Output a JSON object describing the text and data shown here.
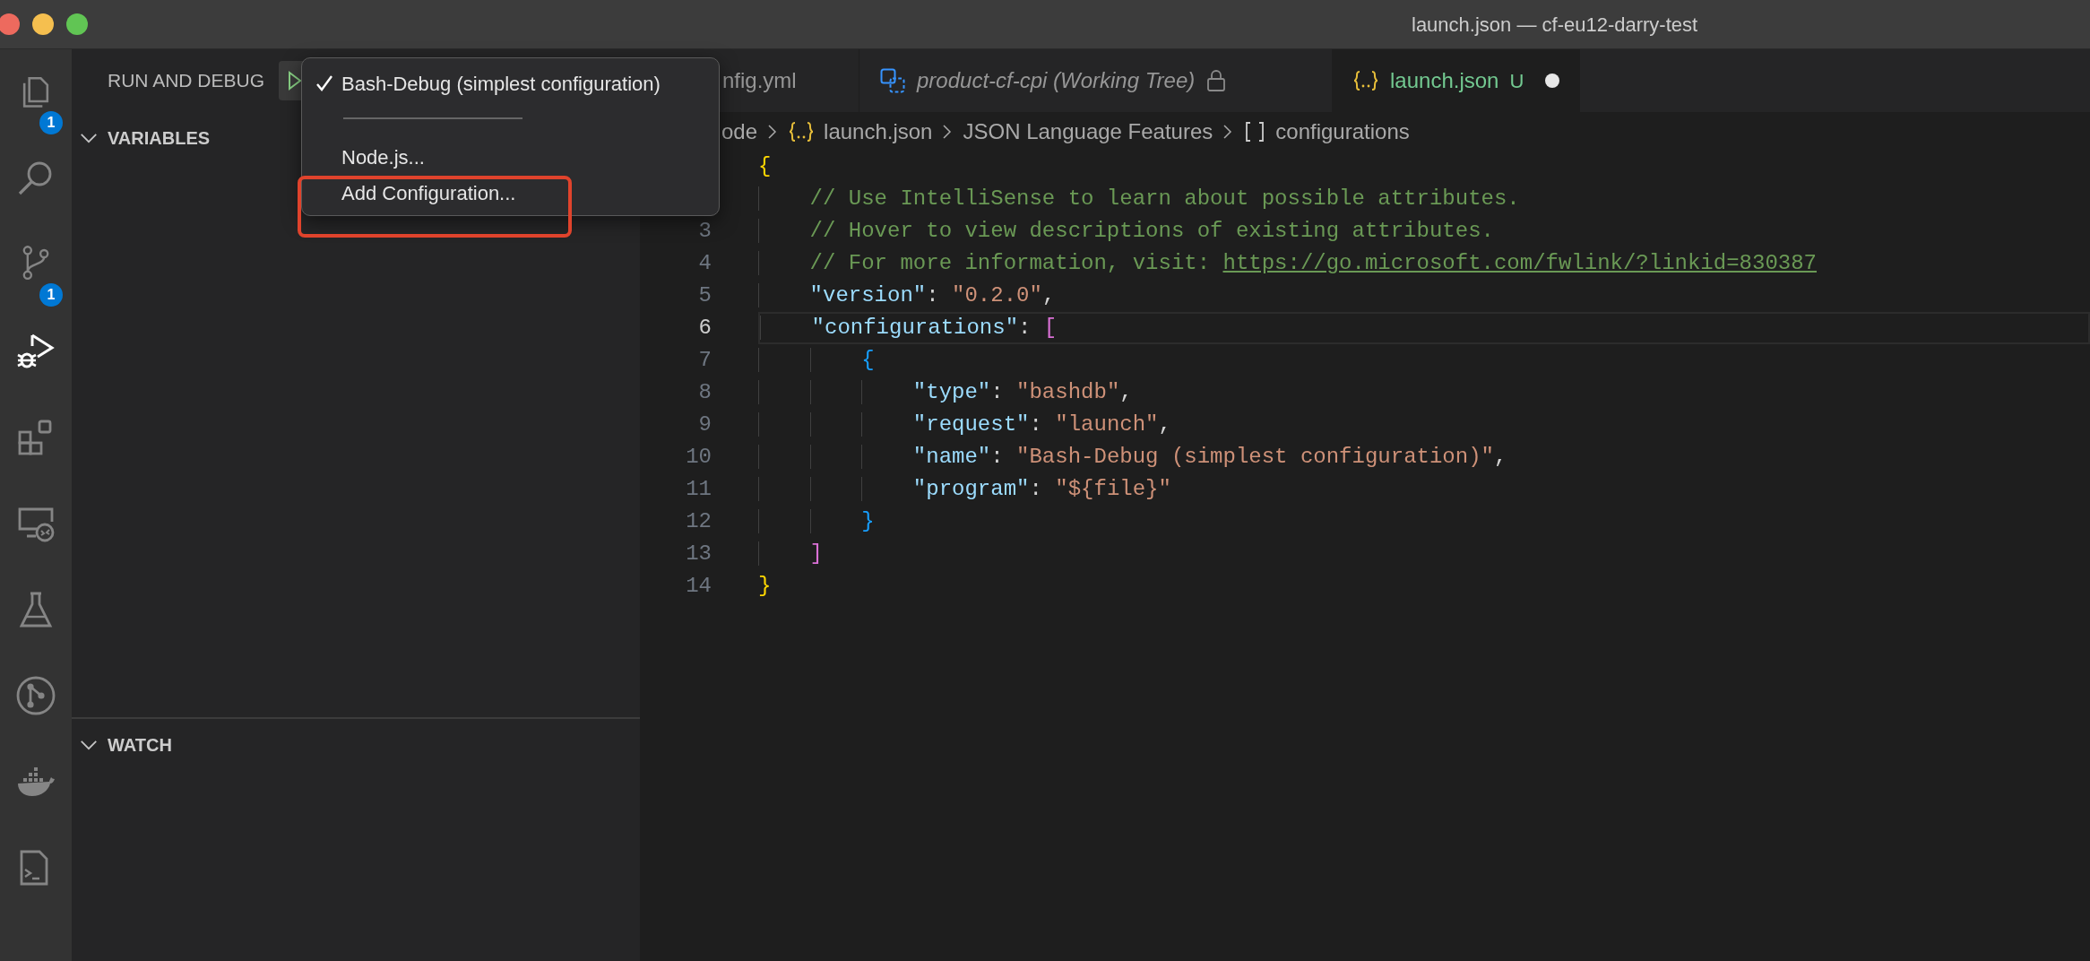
{
  "window": {
    "title": "launch.json — cf-eu12-darry-test"
  },
  "activity_bar": [
    {
      "kind": "files",
      "badge": "1",
      "selected": false
    },
    {
      "kind": "search",
      "selected": false
    },
    {
      "kind": "scm",
      "badge": "1",
      "selected": false
    },
    {
      "kind": "debug",
      "selected": true
    },
    {
      "kind": "extensions",
      "selected": false
    },
    {
      "kind": "remote",
      "selected": false
    },
    {
      "kind": "testing",
      "selected": false
    },
    {
      "kind": "graph",
      "selected": false
    },
    {
      "kind": "docker",
      "selected": false
    },
    {
      "kind": "terminal",
      "selected": false
    }
  ],
  "sidebar": {
    "title": "RUN AND DEBUG",
    "sections": [
      {
        "title": "VARIABLES",
        "expanded": true
      },
      {
        "title": "WATCH",
        "expanded": true
      }
    ]
  },
  "tabs": [
    {
      "kind": "yaml",
      "label": "nfig.yml",
      "preview": false,
      "selected": false
    },
    {
      "kind": "diff",
      "label": "product-cf-cpi (Working Tree)",
      "preview": true,
      "locked": true,
      "selected": false
    },
    {
      "kind": "json",
      "label": "launch.json",
      "status": "U",
      "dirty": true,
      "selected": true
    }
  ],
  "breadcrumb": [
    {
      "kind": "folder",
      "text": "ode"
    },
    {
      "kind": "json",
      "text": "launch.json"
    },
    {
      "kind": "plain",
      "text": "JSON Language Features"
    },
    {
      "kind": "array",
      "text": "configurations"
    }
  ],
  "editor": {
    "lines": [
      {
        "current": false,
        "tokens": [
          {
            "kind": "brace0",
            "text": "{"
          }
        ]
      },
      {
        "current": false,
        "tokens": [
          {
            "kind": "comment",
            "text": "    // Use IntelliSense to learn about possible attributes."
          }
        ]
      },
      {
        "number": "3",
        "current": false,
        "tokens": [
          {
            "kind": "comment",
            "text": "    // Hover to view descriptions of existing attributes."
          }
        ]
      },
      {
        "number": "4",
        "current": false,
        "tokens": [
          {
            "kind": "comment",
            "text": "    // For more information, visit: "
          },
          {
            "kind": "link",
            "text": "https://go.microsoft.com/fwlink/?linkid=830387"
          }
        ]
      },
      {
        "number": "5",
        "current": false,
        "tokens": [
          {
            "kind": "key",
            "text": "    \"version\""
          },
          {
            "kind": "punc",
            "text": ": "
          },
          {
            "kind": "str",
            "text": "\"0.2.0\""
          },
          {
            "kind": "punc",
            "text": ","
          }
        ]
      },
      {
        "number": "6",
        "current": true,
        "tokens": [
          {
            "kind": "key",
            "text": "    \"configurations\""
          },
          {
            "kind": "punc",
            "text": ": "
          },
          {
            "kind": "bracket",
            "text": "["
          }
        ]
      },
      {
        "number": "7",
        "current": false,
        "tokens": [
          {
            "kind": "brace1",
            "text": "        {"
          }
        ]
      },
      {
        "number": "8",
        "current": false,
        "tokens": [
          {
            "kind": "key",
            "text": "            \"type\""
          },
          {
            "kind": "punc",
            "text": ": "
          },
          {
            "kind": "str",
            "text": "\"bashdb\""
          },
          {
            "kind": "punc",
            "text": ","
          }
        ]
      },
      {
        "number": "9",
        "current": false,
        "tokens": [
          {
            "kind": "key",
            "text": "            \"request\""
          },
          {
            "kind": "punc",
            "text": ": "
          },
          {
            "kind": "str",
            "text": "\"launch\""
          },
          {
            "kind": "punc",
            "text": ","
          }
        ]
      },
      {
        "number": "10",
        "current": false,
        "tokens": [
          {
            "kind": "key",
            "text": "            \"name\""
          },
          {
            "kind": "punc",
            "text": ": "
          },
          {
            "kind": "str",
            "text": "\"Bash-Debug (simplest configuration)\""
          },
          {
            "kind": "punc",
            "text": ","
          }
        ]
      },
      {
        "number": "11",
        "current": false,
        "tokens": [
          {
            "kind": "key",
            "text": "            \"program\""
          },
          {
            "kind": "punc",
            "text": ": "
          },
          {
            "kind": "str",
            "text": "\"${file}\""
          }
        ]
      },
      {
        "number": "12",
        "current": false,
        "tokens": [
          {
            "kind": "brace1",
            "text": "        }"
          }
        ]
      },
      {
        "number": "13",
        "current": false,
        "tokens": [
          {
            "kind": "bracket",
            "text": "    ]"
          }
        ]
      },
      {
        "number": "14",
        "current": false,
        "tokens": [
          {
            "kind": "brace0",
            "text": "}"
          }
        ]
      }
    ]
  },
  "menu": {
    "items": [
      {
        "kind": "item",
        "label": "Bash-Debug (simplest configuration)",
        "checked": true
      },
      {
        "kind": "separator"
      },
      {
        "kind": "item",
        "label": "Node.js...",
        "checked": false
      },
      {
        "kind": "item",
        "label": "Add Configuration...",
        "checked": false,
        "highlighted": true
      }
    ]
  }
}
